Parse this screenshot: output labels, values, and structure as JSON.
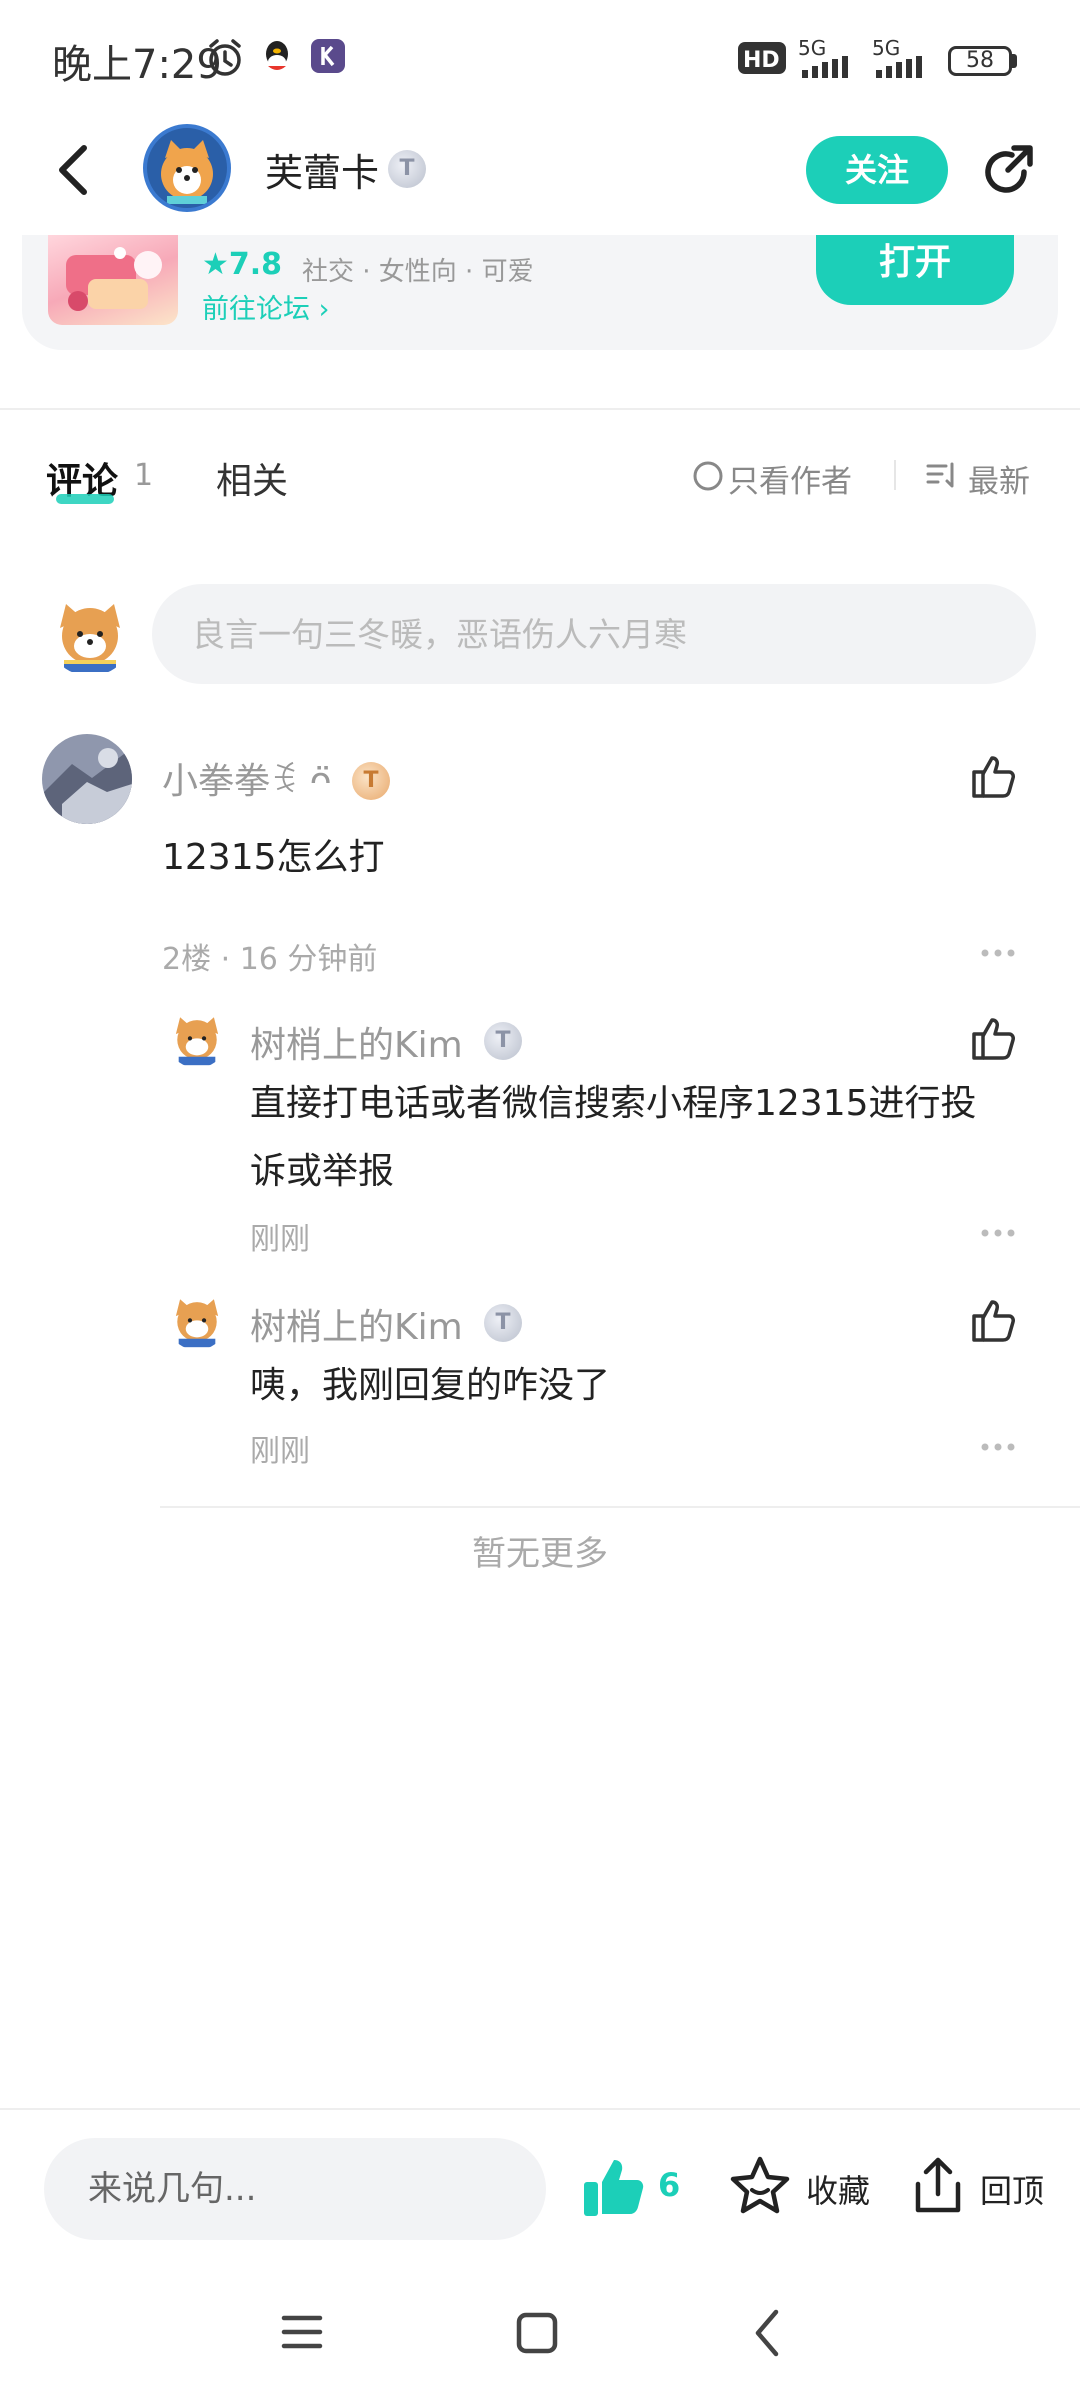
{
  "status_bar": {
    "time": "晚上7:29",
    "network_1": "5G",
    "network_2": "5G",
    "battery": "58"
  },
  "header": {
    "username": "芙蕾卡",
    "level_badge": "T",
    "follow_label": "关注"
  },
  "app_card": {
    "rating": "★7.8",
    "tags": "社交 · 女性向 · 可爱",
    "forum_link": "前往论坛 ›",
    "open_label": "打开"
  },
  "tabs": {
    "comments_label": "评论",
    "comments_count": "1",
    "related_label": "相关",
    "author_only_label": "只看作者",
    "sort_label": "最新"
  },
  "comment_input": {
    "placeholder": "良言一句三冬暖，恶语伤人六月寒"
  },
  "comments": [
    {
      "username": "小拳拳ꉂ ᴖ̈",
      "level": "T",
      "text": "12315怎么打",
      "meta": "2楼 · 16 分钟前",
      "replies": [
        {
          "username": "树梢上的Kim",
          "level": "T",
          "text_line1": "直接打电话或者微信搜索小程序12315进行投",
          "text_line2": "诉或举报",
          "meta": "刚刚"
        },
        {
          "username": "树梢上的Kim",
          "level": "T",
          "text_line1": "咦，我刚回复的咋没了",
          "meta": "刚刚"
        }
      ]
    }
  ],
  "end_text": "暂无更多",
  "bottom_bar": {
    "input_placeholder": "来说几句...",
    "like_count": "6",
    "favorite_label": "收藏",
    "back_top_label": "回顶"
  },
  "colors": {
    "accent": "#1ccfb8",
    "muted_text": "#999999",
    "input_bg": "#f2f3f5"
  }
}
